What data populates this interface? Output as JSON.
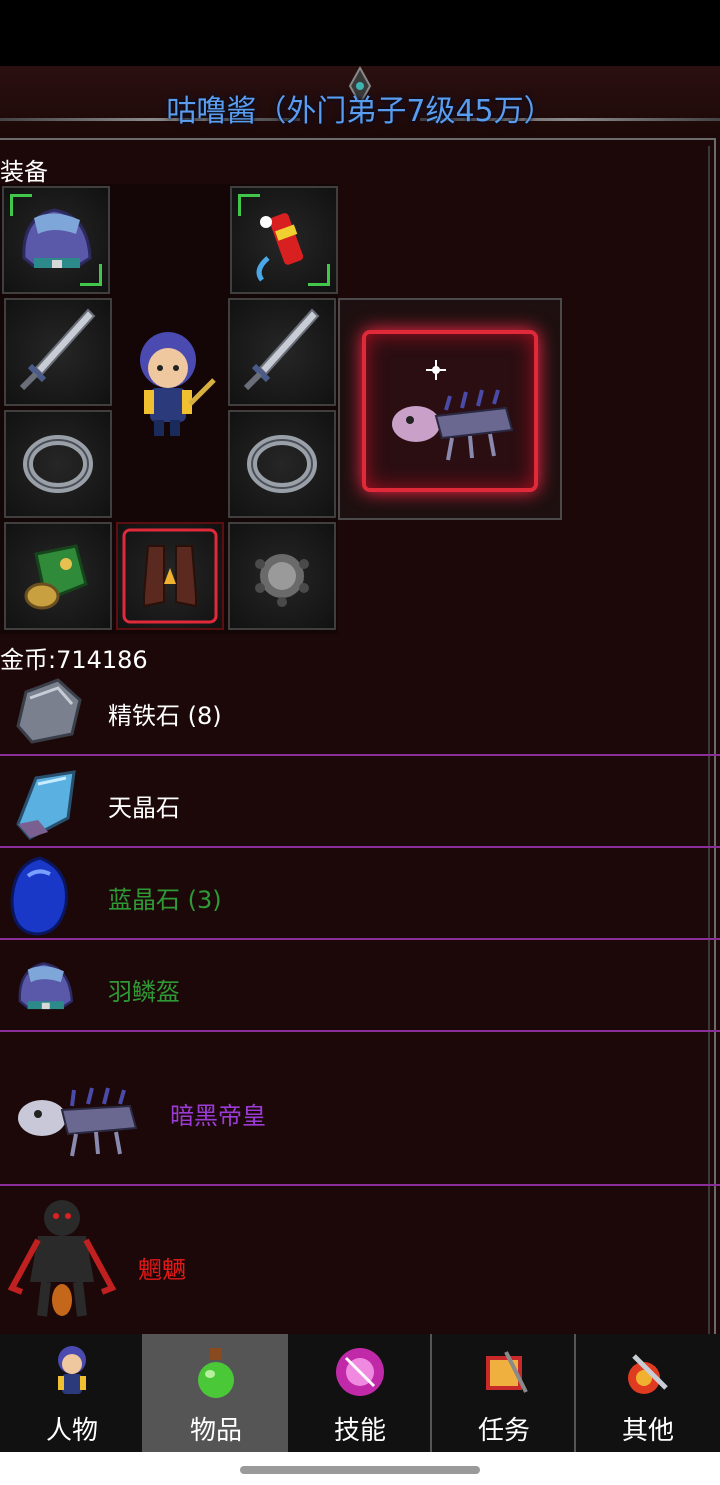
{
  "header": {
    "title": "咕噜酱（外门弟子7级45万）"
  },
  "equipment": {
    "section_label": "装备",
    "slots": [
      {
        "name": "helmet-slot",
        "icon": "helmet-icon"
      },
      {
        "name": "armor-slot",
        "icon": "robe-icon"
      },
      {
        "name": "talisman-slot",
        "icon": "firecracker-icon"
      },
      {
        "name": "weapon-left-slot",
        "icon": "sword-icon"
      },
      {
        "name": "weapon-right-slot",
        "icon": "sword-icon"
      },
      {
        "name": "ring-left-slot",
        "icon": "ring-icon"
      },
      {
        "name": "ring-right-slot",
        "icon": "ring-icon"
      },
      {
        "name": "bracer-slot",
        "icon": "bracer-icon"
      },
      {
        "name": "boots-slot",
        "icon": "boots-icon"
      },
      {
        "name": "beads-slot",
        "icon": "beads-icon"
      }
    ],
    "pet_slot_icon": "skeleton-beast-icon"
  },
  "wallet": {
    "coins_label": "金币:714186"
  },
  "inventory": {
    "items": [
      {
        "label": "精铁石 (8)",
        "color": "#ffffff",
        "icon": "iron-ore-icon"
      },
      {
        "label": "天晶石",
        "color": "#ffffff",
        "icon": "sky-crystal-icon"
      },
      {
        "label": "蓝晶石 (3)",
        "color": "#2e9a35",
        "icon": "blue-crystal-icon"
      },
      {
        "label": "羽鳞盔",
        "color": "#2e9a35",
        "icon": "helmet-icon"
      },
      {
        "label": "暗黑帝皇",
        "color": "#9b3bd6",
        "icon": "skeleton-beast-icon"
      },
      {
        "label": "魍魉",
        "color": "#e01818",
        "icon": "demon-icon"
      }
    ]
  },
  "tabs": [
    {
      "label": "人物",
      "icon": "character-icon",
      "active": false
    },
    {
      "label": "物品",
      "icon": "potion-icon",
      "active": true
    },
    {
      "label": "技能",
      "icon": "skill-orb-icon",
      "active": false
    },
    {
      "label": "任务",
      "icon": "quest-flag-icon",
      "active": false
    },
    {
      "label": "其他",
      "icon": "sword-shield-icon",
      "active": false
    }
  ],
  "colors": {
    "title": "#5a9cf0",
    "separator": "#8a2f9a",
    "background": "#1c0808"
  }
}
